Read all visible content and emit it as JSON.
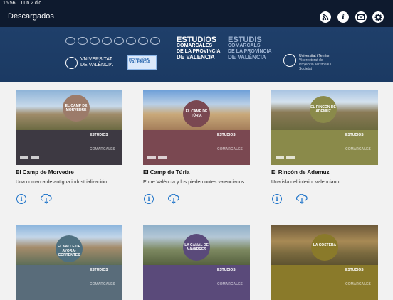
{
  "status": {
    "time": "16:56",
    "date": "Lun 2 dic"
  },
  "nav": {
    "title": "Descargados",
    "icons": [
      "rss-icon",
      "info-icon",
      "mail-icon",
      "settings-icon"
    ],
    "accent": "#0e1a2e"
  },
  "banner": {
    "uv_line1": "VNIVERSITAT",
    "uv_line2": "DE VALÈNCIA",
    "dip_line1": "DIPUTACIÓ DE",
    "dip_line2": "VALENCIA",
    "es_title": "ESTUDIOS",
    "es_sub1": "COMARCALES",
    "es_sub2": "DE LA PROVINCIA",
    "es_sub3": "DE VALENCIA",
    "va_title": "ESTUDIS",
    "va_sub1": "COMARCALS",
    "va_sub2": "DE LA PROVÍNCIA",
    "va_sub3": "DE VALÈNCIA",
    "ut_line1": "Universitat i Territori",
    "ut_line2": "Vicerectorat de Projecció Territorial i Societat"
  },
  "cards": [
    {
      "title": "El Camp de Morvedre",
      "subtitle": "Una comarca de antigua industrialización",
      "badge": "EL CAMP DE MORVEDRE",
      "band_color": "#3d3942",
      "badge_color": "#9c7b6a"
    },
    {
      "title": "El Camp de Túria",
      "subtitle": "Entre València y los piedemontes valencianos",
      "badge": "EL CAMP DE TÚRIA",
      "band_color": "#7a4851",
      "badge_color": "#7a4851"
    },
    {
      "title": "El Rincón de Ademuz",
      "subtitle": "Una isla del interior valenciano",
      "badge": "EL RINCÓN DE ADEMUZ",
      "band_color": "#8a8a4a",
      "badge_color": "#8a8a4a"
    },
    {
      "title": "",
      "subtitle": "",
      "badge": "EL VALLE DE AYORA-COFRENTES",
      "band_color": "#596c7a",
      "badge_color": "#4f7080"
    },
    {
      "title": "",
      "subtitle": "",
      "badge": "LA CANAL DE NAVARRÉS",
      "band_color": "#5a4a7a",
      "badge_color": "#5a4a7a"
    },
    {
      "title": "",
      "subtitle": "",
      "badge": "LA COSTERA",
      "band_color": "#8a7a2a",
      "badge_color": "#8a7a2a"
    }
  ],
  "cover_text": {
    "line1": "ESTUDIOS",
    "line2": "COMARCALES",
    "line3": "DE LA PROVINCIA",
    "line4": "DE VALENCIA"
  },
  "info_glyph": "i"
}
